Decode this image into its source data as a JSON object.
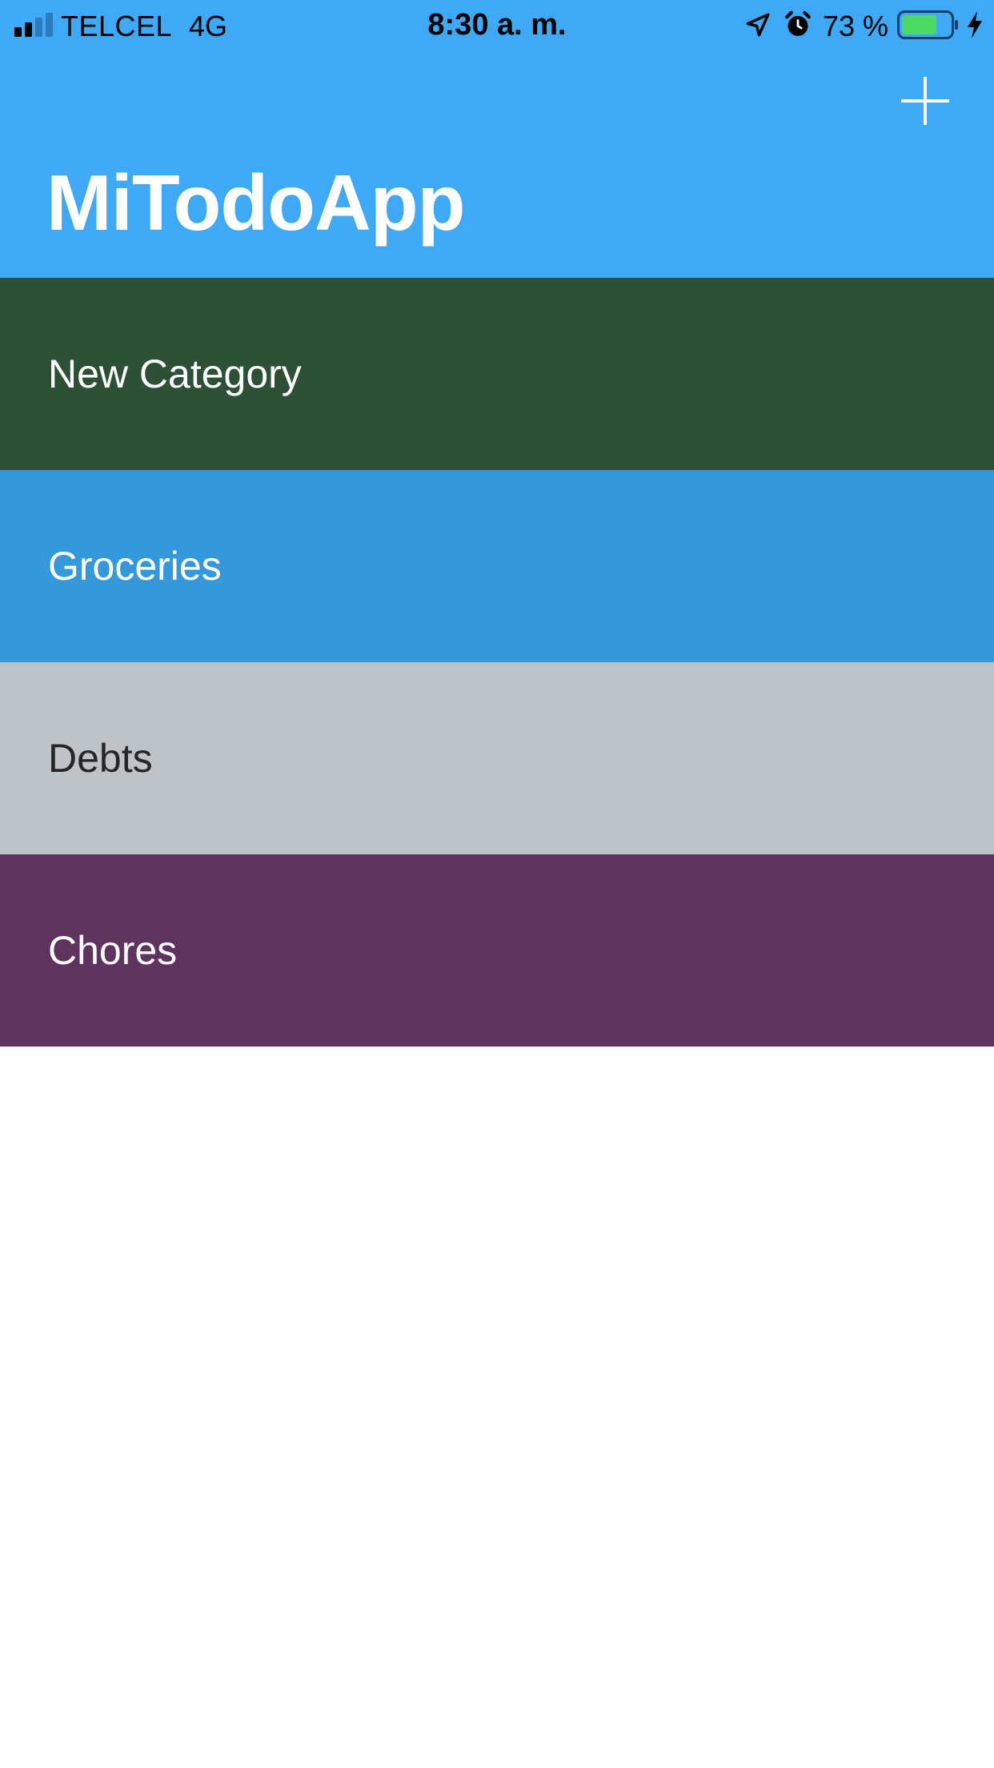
{
  "status_bar": {
    "carrier": "TELCEL",
    "network": "4G",
    "time": "8:30 a. m.",
    "battery_percent": "73 %",
    "battery_level": 0.73,
    "icons": [
      "signal-icon",
      "location-arrow-icon",
      "alarm-icon",
      "battery-icon",
      "charging-bolt-icon"
    ]
  },
  "header": {
    "title": "MiTodoApp",
    "add_icon": "plus-icon",
    "background": "#3fa9f5"
  },
  "categories": [
    {
      "name": "New Category",
      "color": "#2d5036",
      "text_color": "#ffffff"
    },
    {
      "name": "Groceries",
      "color": "#3498db",
      "text_color": "#ffffff"
    },
    {
      "name": "Debts",
      "color": "#bdc3c7",
      "text_color": "#262626"
    },
    {
      "name": "Chores",
      "color": "#5e345e",
      "text_color": "#ffffff"
    }
  ]
}
